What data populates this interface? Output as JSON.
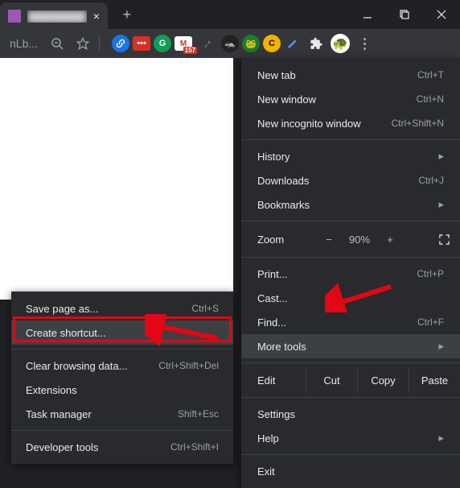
{
  "titlebar": {
    "tab_title": "████████",
    "favicon": "square-purple-icon"
  },
  "toolbar": {
    "addr_fragment": "nLb...",
    "gm_badge": "157"
  },
  "menu": {
    "new_tab": "New tab",
    "new_tab_cut": "Ctrl+T",
    "new_window": "New window",
    "new_window_cut": "Ctrl+N",
    "new_incognito": "New incognito window",
    "new_incognito_cut": "Ctrl+Shift+N",
    "history": "History",
    "downloads": "Downloads",
    "downloads_cut": "Ctrl+J",
    "bookmarks": "Bookmarks",
    "zoom_label": "Zoom",
    "zoom_dec": "−",
    "zoom_val": "90%",
    "zoom_inc": "+",
    "print": "Print...",
    "print_cut": "Ctrl+P",
    "cast": "Cast...",
    "find": "Find...",
    "find_cut": "Ctrl+F",
    "more_tools": "More tools",
    "edit": "Edit",
    "cut": "Cut",
    "copy": "Copy",
    "paste": "Paste",
    "settings": "Settings",
    "help": "Help",
    "exit": "Exit"
  },
  "submenu": {
    "save_page": "Save page as...",
    "save_page_cut": "Ctrl+S",
    "create_shortcut": "Create shortcut...",
    "clear_data": "Clear browsing data...",
    "clear_data_cut": "Ctrl+Shift+Del",
    "extensions": "Extensions",
    "task_manager": "Task manager",
    "task_manager_cut": "Shift+Esc",
    "dev_tools": "Developer tools",
    "dev_tools_cut": "Ctrl+Shift+I"
  }
}
